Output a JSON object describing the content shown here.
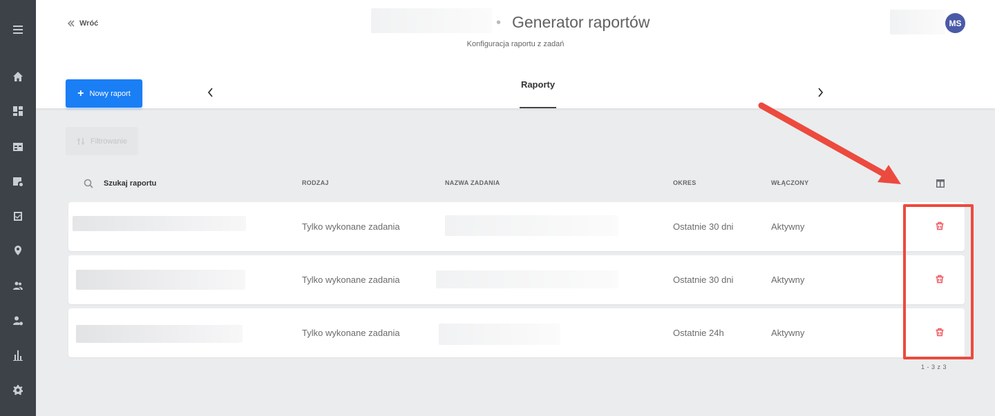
{
  "header": {
    "back_label": "Wróć",
    "title": "Generator raportów",
    "subtitle": "Konfiguracja raportu z zadań",
    "avatar_initials": "MS",
    "new_report_label": "Nowy raport",
    "tab_label": "Raporty"
  },
  "toolbar": {
    "filter_label": "Filtrowanie"
  },
  "table": {
    "search_placeholder": "Szukaj raportu",
    "columns": {
      "type": "RODZAJ",
      "task_name": "NAZWA ZADANIA",
      "period": "OKRES",
      "enabled": "WŁĄCZONY"
    },
    "rows": [
      {
        "type": "Tylko wykonane zadania",
        "period": "Ostatnie 30 dni",
        "enabled": "Aktywny"
      },
      {
        "type": "Tylko wykonane zadania",
        "period": "Ostatnie 30 dni",
        "enabled": "Aktywny"
      },
      {
        "type": "Tylko wykonane zadania",
        "period": "Ostatnie 24h",
        "enabled": "Aktywny"
      }
    ],
    "pagination": "1 - 3 z 3"
  },
  "colors": {
    "sidebar": "#3d4248",
    "primary": "#1a7ef5",
    "avatar": "#4a5aa8",
    "delete": "#f0525a",
    "annotation": "#ec4a3e"
  },
  "icons": {
    "sidebar": [
      "menu-icon",
      "home-icon",
      "dashboard-icon",
      "calendar-icon",
      "task-settings-icon",
      "checklist-icon",
      "location-icon",
      "users-icon",
      "user-gear-icon",
      "reports-icon",
      "settings-icon"
    ]
  }
}
